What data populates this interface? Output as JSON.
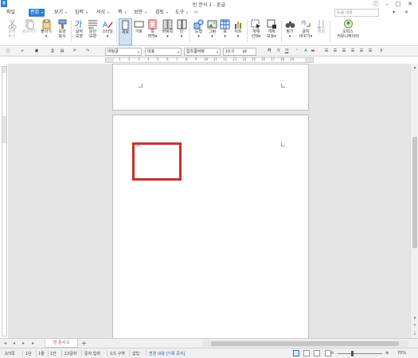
{
  "window": {
    "title": "빈 문서 1 - 훈글",
    "app_icon": "ㅎ",
    "controls": [
      "ⓘ",
      "–",
      "□",
      "✕"
    ]
  },
  "menu": {
    "file": "파일",
    "items": [
      "편집",
      "보기",
      "입력",
      "서식",
      "쪽",
      "보안",
      "검토",
      "도구"
    ],
    "extra_icon": "≪",
    "help_placeholder": "도움 내용",
    "right_icons": [
      "▾",
      "✕"
    ]
  },
  "ribbon": {
    "cut": [
      "오려",
      "두기"
    ],
    "copy": "복사하기",
    "paste": [
      "붙이기",
      "▾"
    ],
    "format_copy": [
      "모양",
      "복사"
    ],
    "char_shape": [
      "글자",
      "모양"
    ],
    "para_shape": [
      "문단",
      "모양"
    ],
    "style": [
      "스타일",
      "▾"
    ],
    "vertical": [
      "세로"
    ],
    "horizontal": [
      "가로"
    ],
    "page_margin": [
      "쪽",
      "여백▾"
    ],
    "background": [
      "바탕쪽",
      "▾"
    ],
    "column": [
      "단",
      "▾"
    ],
    "shape": [
      "도형",
      "▾"
    ],
    "picture": [
      "그림",
      "▾"
    ],
    "table": [
      "표",
      "▾"
    ],
    "chart": [
      "차트",
      "▾"
    ],
    "select_object": [
      "개체",
      "선택▾"
    ],
    "object_protect": [
      "개체",
      "보호▾"
    ],
    "find": [
      "찾기",
      "▾"
    ],
    "replace": [
      "글자",
      "바꾸기▾"
    ],
    "sort": [
      "정렬"
    ],
    "office_community": [
      "오피스",
      "커뮤니케이터"
    ]
  },
  "format_bar": {
    "style_value": "바탕글",
    "lang_value": "대표",
    "font_value": "함초롬바탕",
    "size_value": "10.0",
    "size_unit": "pt",
    "bold": "가",
    "italic": "가",
    "underline": "가"
  },
  "ruler_numbers": [
    "1",
    "2",
    "3",
    "4",
    "5",
    "6",
    "7",
    "8",
    "9",
    "10",
    "11",
    "12",
    "13",
    "14",
    "15",
    "16",
    "17",
    "18",
    "19"
  ],
  "tabs": {
    "doc_tab": "빈 문서 1",
    "add": "+",
    "nav": [
      "◂",
      "◂",
      "▸",
      "▸"
    ]
  },
  "status": {
    "page": "2/3쪽",
    "section": "1단",
    "line": "1줄",
    "col": "1칸",
    "chars": "13글자",
    "input_mode": "문자 입력",
    "block": "1/1 구역",
    "insert": "삽입",
    "track_changes": "변경 내용 [기록 중지]",
    "zoom": "70%",
    "zoom_minus": "⊖",
    "zoom_plus": "⊕"
  },
  "colors": {
    "accent": "#2a7fd4",
    "textbox_border": "#c9302c",
    "workspace": "#e5e5e5"
  }
}
